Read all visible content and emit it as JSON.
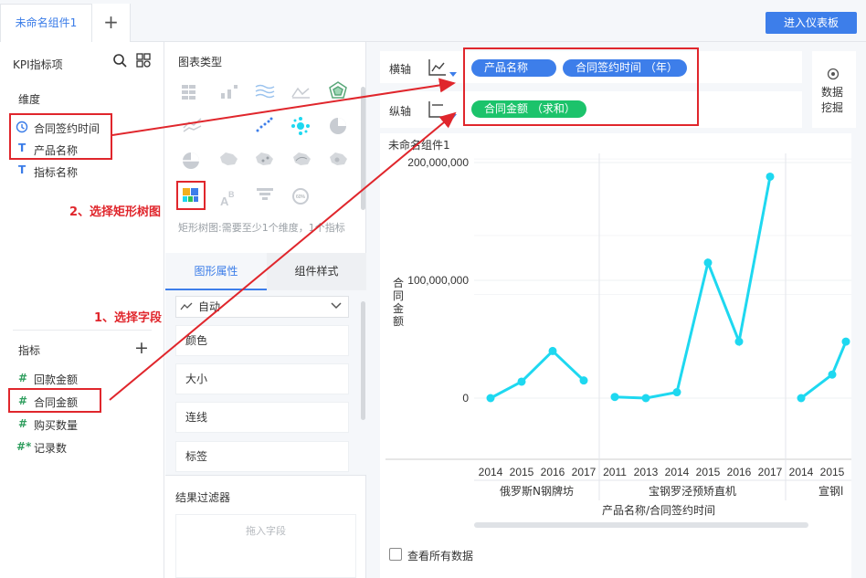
{
  "tabs": {
    "active": "未命名组件1",
    "add": "+"
  },
  "toolbar": {
    "enter_dashboard": "进入仪表板"
  },
  "left_panel": {
    "title": "KPI指标项",
    "dimensions_title": "维度",
    "dimensions": [
      "合同签约时间",
      "产品名称",
      "指标名称"
    ],
    "metrics_title": "指标",
    "metrics": [
      "回款金额",
      "合同金额",
      "购买数量",
      "记录数"
    ],
    "metric_icons": [
      "#",
      "#",
      "#",
      "#*"
    ]
  },
  "chart_types": {
    "title": "图表类型",
    "hint": "矩形树图:需要至少1个维度，1个指标",
    "icons": [
      "table-icon",
      "bar-icon",
      "line-icon",
      "area-icon",
      "radar-icon",
      "stacked-area-icon",
      "scatter-icon",
      "bubble-icon",
      "pie-icon",
      "donut-icon",
      "map-icon",
      "point-map-icon",
      "flow-map-icon",
      "heat-map-icon",
      "treemap-icon",
      "word-cloud-icon",
      "funnel-icon",
      "gauge-icon"
    ]
  },
  "props_tabs": {
    "shape": "图形属性",
    "style": "组件样式"
  },
  "props": {
    "mode": "自动",
    "color": "颜色",
    "size": "大小",
    "line": "连线",
    "label": "标签"
  },
  "filter": {
    "title": "结果过滤器",
    "placeholder": "拖入字段"
  },
  "axes": {
    "x_label": "横轴",
    "y_label": "纵轴",
    "x_pills": [
      "产品名称",
      "合同签约时间 （年）"
    ],
    "y_pills": [
      "合同金额 （求和）"
    ],
    "data_mining": "数据\n挖掘"
  },
  "annotations": {
    "step1": "1、选择字段",
    "step2": "2、选择矩形树图"
  },
  "chart_title": "未命名组件1",
  "show_all": "查看所有数据",
  "colors": {
    "accent": "#3d7eea",
    "green": "#1cc36b",
    "line": "#1ed8f0",
    "red": "#e0262c"
  },
  "chart_data": {
    "type": "line",
    "title": "未命名组件1",
    "ylabel": "合同金额",
    "xlabel": "产品名称/合同签约时间",
    "ylim": [
      -20000000,
      220000000
    ],
    "yticks": [
      "200,000,000",
      "100,000,000",
      "0"
    ],
    "groups": [
      {
        "name": "俄罗斯N钢牌坊",
        "x": [
          "2014",
          "2015",
          "2016",
          "2017"
        ],
        "values": [
          0,
          14000000,
          40000000,
          15000000
        ]
      },
      {
        "name": "宝钢罗泾预矫直机",
        "x": [
          "2011",
          "2013",
          "2014",
          "2015",
          "2016",
          "2017"
        ],
        "values": [
          1000000,
          0,
          5000000,
          115000000,
          48000000,
          188000000
        ]
      },
      {
        "name": "宣钢l",
        "x": [
          "2014",
          "2015"
        ],
        "values": [
          0,
          20000000,
          48000000
        ]
      }
    ]
  }
}
